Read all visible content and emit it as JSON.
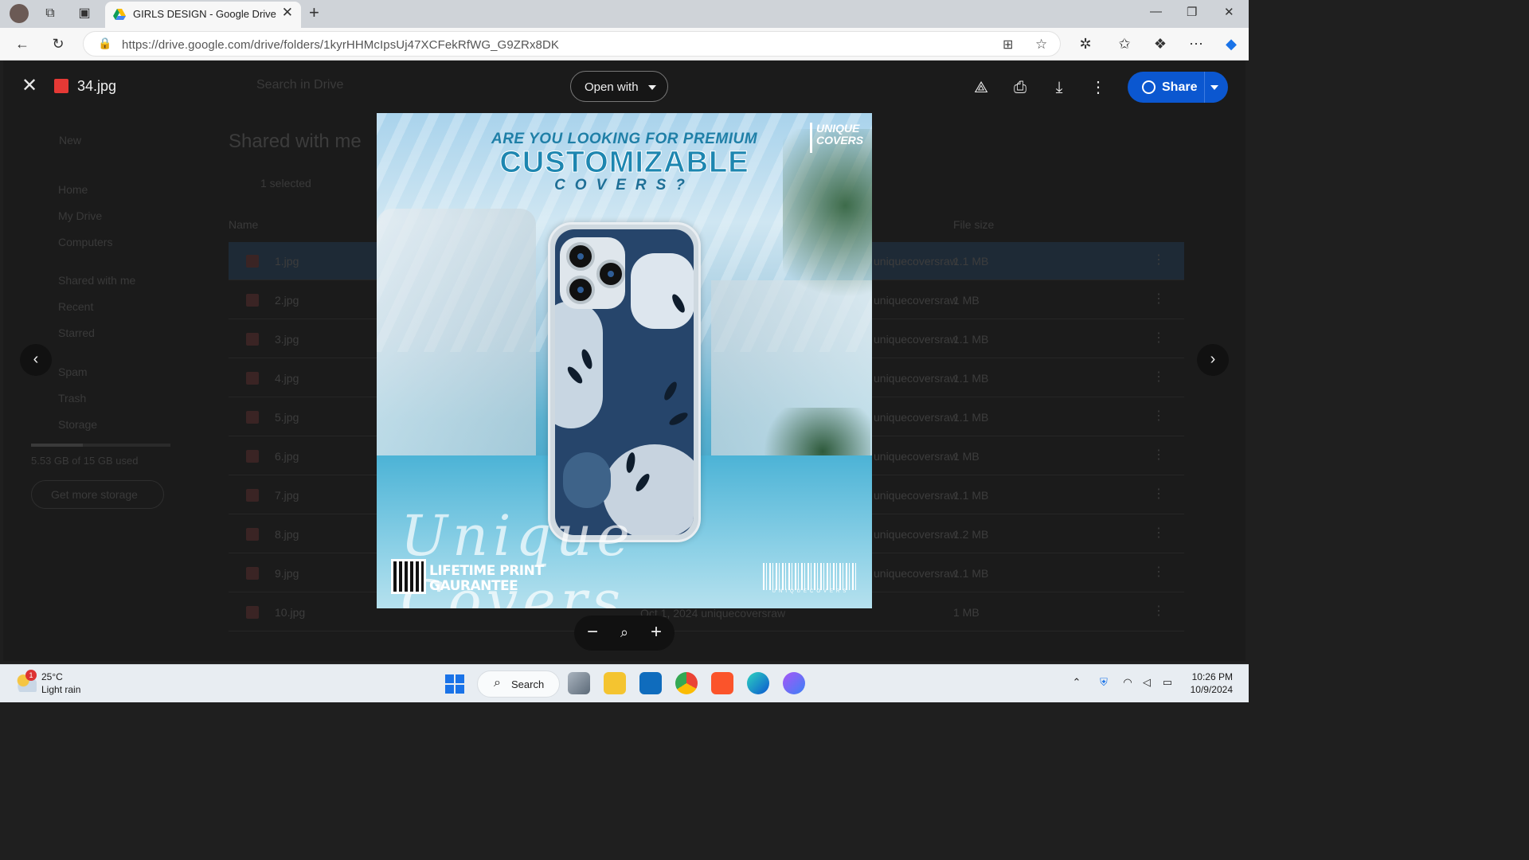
{
  "browser": {
    "tab_title": "GIRLS DESIGN - Google Drive",
    "url": "https://drive.google.com/drive/folders/1kyrHHMcIpsUj47XCFekRfWG_G9ZRx8DK"
  },
  "drive": {
    "search_placeholder": "Search in Drive",
    "new_label": "New",
    "page_title": "Shared with me",
    "selected_label": "1 selected",
    "nav": [
      "Home",
      "My Drive",
      "Computers",
      "Shared with me",
      "Recent",
      "Starred",
      "Spam",
      "Trash",
      "Storage"
    ],
    "storage_used": "5.53 GB of 15 GB used",
    "storage_fraction": 0.37,
    "get_storage": "Get more storage",
    "col_name": "Name",
    "col_size": "File size",
    "files": [
      {
        "name": "1.jpg",
        "owner": "uniquecoversraw",
        "size": "1.1 MB"
      },
      {
        "name": "2.jpg",
        "owner": "uniquecoversraw",
        "size": "1 MB"
      },
      {
        "name": "3.jpg",
        "owner": "uniquecoversraw",
        "size": "1.1 MB"
      },
      {
        "name": "4.jpg",
        "owner": "uniquecoversraw",
        "size": "1.1 MB"
      },
      {
        "name": "5.jpg",
        "owner": "uniquecoversraw",
        "size": "1.1 MB"
      },
      {
        "name": "6.jpg",
        "owner": "uniquecoversraw",
        "size": "1 MB"
      },
      {
        "name": "7.jpg",
        "owner": "uniquecoversraw",
        "size": "1.1 MB"
      },
      {
        "name": "8.jpg",
        "owner": "uniquecoversraw",
        "size": "1.2 MB"
      },
      {
        "name": "9.jpg",
        "owner": "uniquecoversraw",
        "size": "1.1 MB"
      },
      {
        "name": "10.jpg",
        "owner": "uniquecoversraw",
        "size": "1 MB"
      }
    ],
    "last_row_extra": "Oct 1, 2024 uniquecoversraw"
  },
  "viewer": {
    "filename": "34.jpg",
    "open_with": "Open with",
    "share": "Share"
  },
  "image": {
    "heading_small": "ARE YOU LOOKING FOR PREMIUM",
    "heading_big": "CUSTOMIZABLE",
    "heading_spaced": "COVERS?",
    "logo_line1": "UNIQUE",
    "logo_line2": "COVERS",
    "guarantee_line1": "LIFETIME PRINT",
    "guarantee_line2": "GAURANTEE",
    "barcode_text": "UNIQUECOVERS",
    "script_text": "Unique Covers"
  },
  "taskbar": {
    "temp": "25°C",
    "weather": "Light rain",
    "weather_badge": "1",
    "search": "Search",
    "time": "10:26 PM",
    "date": "10/9/2024"
  },
  "colors": {
    "share_blue": "#0b57d0",
    "dim_bg": "#1b1b1b"
  }
}
